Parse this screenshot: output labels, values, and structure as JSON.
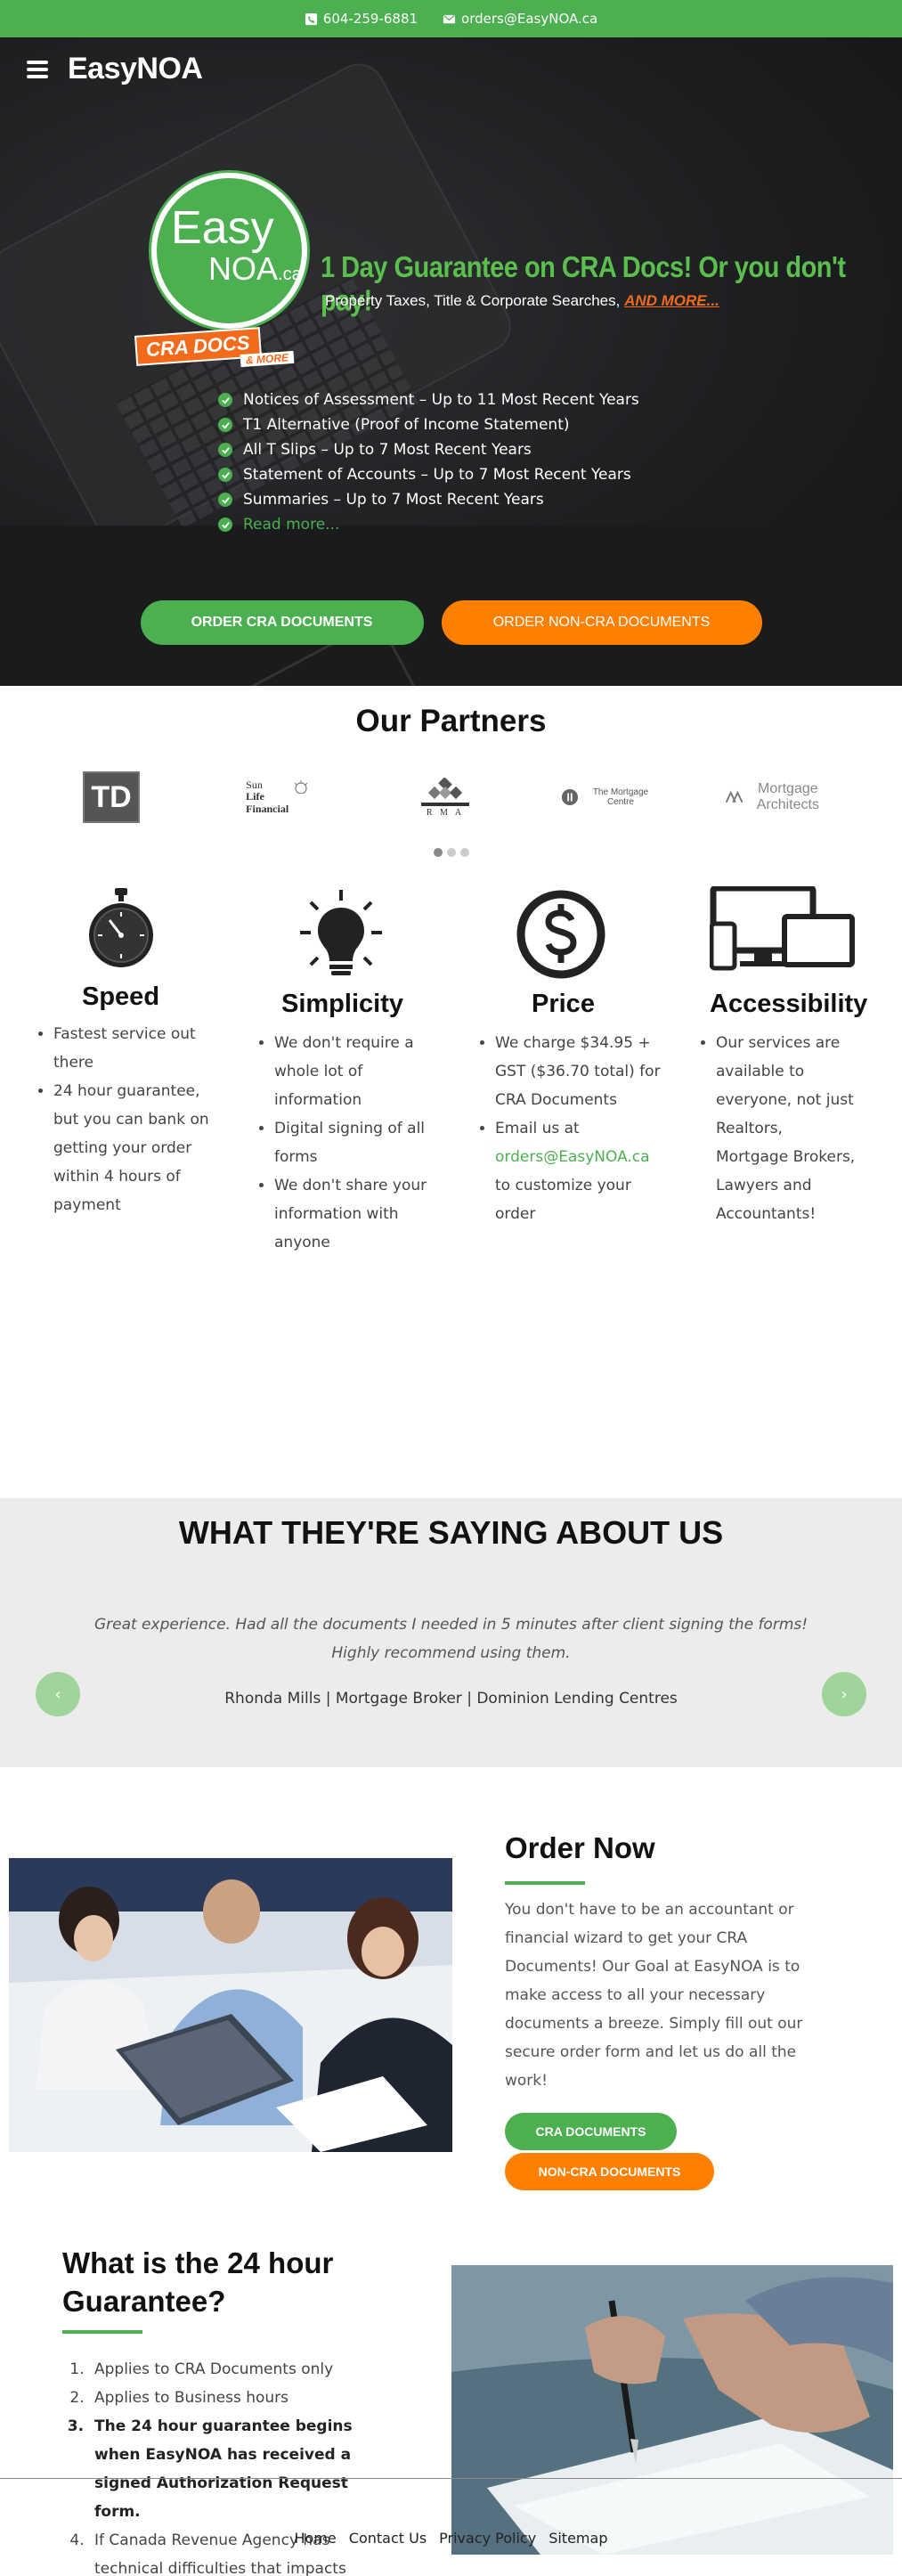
{
  "topbar": {
    "phone": "604-259-6881",
    "email": "orders@EasyNOA.ca"
  },
  "header": {
    "brand": "EasyNOA"
  },
  "logo": {
    "easy": "Easy",
    "noa": "NOA",
    "ca": ".ca",
    "ribbon": "CRA DOCS",
    "more": "& MORE"
  },
  "hero": {
    "headline": "1 Day Guarantee on CRA Docs! Or you don't pay!",
    "subline": "Property Taxes, Title & Corporate Searches,",
    "subline_more": "AND MORE...",
    "items": [
      "Notices of Assessment – Up to 11 Most Recent Years",
      "T1 Alternative (Proof of Income Statement)",
      "All T Slips – Up to 7 Most Recent Years",
      "Statement of Accounts – Up to 7 Most Recent Years",
      "Summaries – Up to 7 Most Recent Years"
    ],
    "read_more": "Read more...",
    "btn_cra": "ORDER CRA DOCUMENTS",
    "btn_noncra": "ORDER NON-CRA DOCUMENTS"
  },
  "partners": {
    "title": "Our Partners",
    "td": "TD",
    "sunlife_1": "Sun",
    "sunlife_2": "Life Financial",
    "rma": "R M A",
    "mortgage_centre": "The Mortgage Centre",
    "mortgage_architects": "Mortgage Architects"
  },
  "features": {
    "speed": {
      "title": "Speed",
      "items": [
        "Fastest service out there",
        "24 hour guarantee, but you can bank on getting your order within 4 hours of payment"
      ]
    },
    "simplicity": {
      "title": "Simplicity",
      "items": [
        "We don't require a whole lot of information",
        "Digital signing of all forms",
        "We don't share your information with anyone"
      ]
    },
    "price": {
      "title": "Price",
      "item1": "We charge $34.95 + GST ($36.70 total) for CRA Documents",
      "item2_pre": "Email us at",
      "item2_email": "orders@EasyNOA.ca",
      "item2_post": "to customize your order"
    },
    "accessibility": {
      "title": "Accessibility",
      "items": [
        "Our services are available to everyone, not just Realtors, Mortgage Brokers, Lawyers and Accountants!"
      ]
    }
  },
  "testimonials": {
    "title": "WHAT THEY'RE SAYING ABOUT US",
    "quote_line1": "Great experience. Had all the documents I needed in 5 minutes after client signing the forms!",
    "quote_line2": "Highly recommend using them.",
    "author": "Rhonda Mills | Mortgage Broker | Dominion Lending Centres",
    "prev": "‹",
    "next": "›"
  },
  "order": {
    "title": "Order Now",
    "text": "You don't have to be an accountant or financial wizard to get your CRA Documents! Our Goal at EasyNOA is to make access to all your necessary documents a breeze. Simply fill out our secure order form and let us do all the work!",
    "btn_cra": "CRA DOCUMENTS",
    "btn_noncra": "NON-CRA DOCUMENTS"
  },
  "guarantee": {
    "title": "What is the 24 hour Guarantee?",
    "items": [
      "Applies to CRA Documents only",
      "Applies to Business hours",
      "The 24 hour guarantee begins when EasyNOA has received a signed Authorization Request form.",
      "If Canada Revenue Agency has technical difficulties that impacts EasyNOA's ability to fulfill orders, the 24 hour guarantee will start once CRA is up and running again."
    ]
  },
  "footer": {
    "links": [
      "Home",
      "Contact Us",
      "Privacy Policy",
      "Sitemap"
    ]
  },
  "colors": {
    "green": "#4caf50",
    "orange": "#ff7f00",
    "dark": "#1d1e20"
  }
}
